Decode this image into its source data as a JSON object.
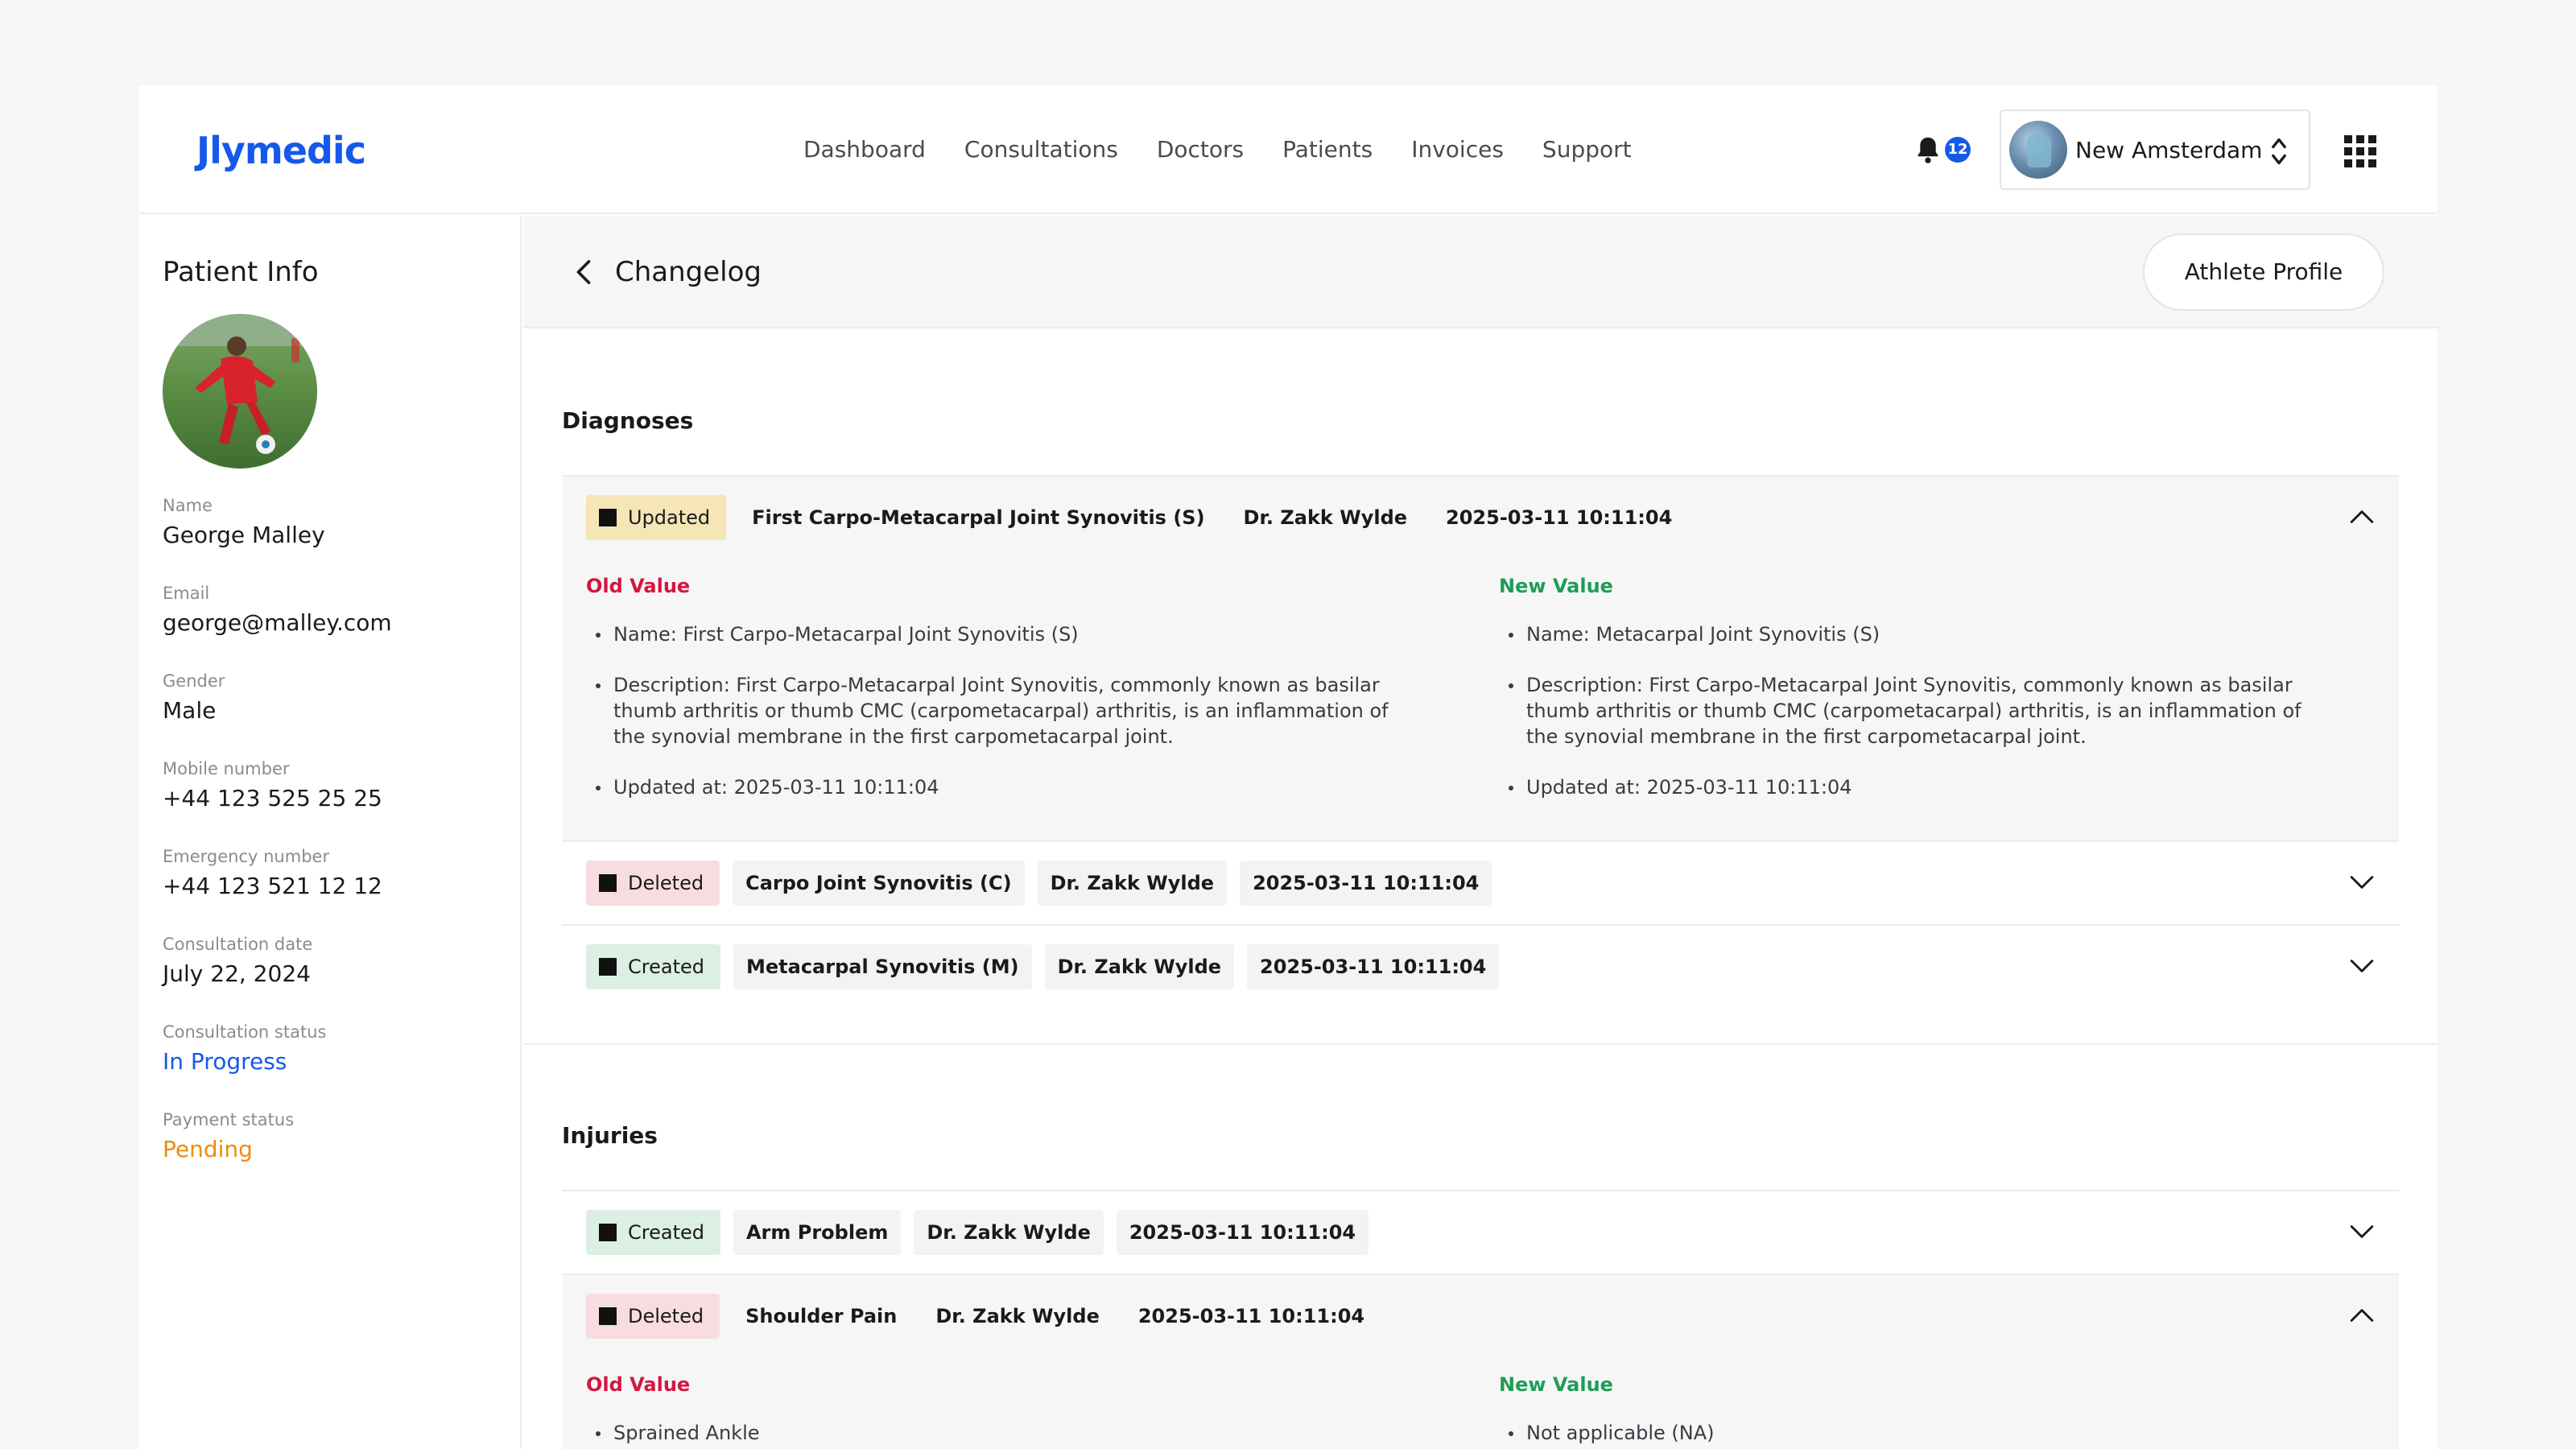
{
  "header": {
    "logo": "Jlymedic",
    "nav": [
      "Dashboard",
      "Consultations",
      "Doctors",
      "Patients",
      "Invoices",
      "Support"
    ],
    "notifications_count": "12",
    "organization": "New Amsterdam"
  },
  "sidebar": {
    "title": "Patient Info",
    "fields": [
      {
        "label": "Name",
        "value": "George Malley"
      },
      {
        "label": "Email",
        "value": "george@malley.com"
      },
      {
        "label": "Gender",
        "value": "Male"
      },
      {
        "label": "Mobile number",
        "value": "+44 123 525 25 25"
      },
      {
        "label": "Emergency number",
        "value": "+44 123 521 12 12"
      },
      {
        "label": "Consultation date",
        "value": "July 22, 2024"
      },
      {
        "label": "Consultation status",
        "value": "In Progress"
      },
      {
        "label": "Payment status",
        "value": "Pending"
      }
    ]
  },
  "main": {
    "title": "Changelog",
    "athlete_profile_button": "Athlete Profile",
    "diagnoses": {
      "title": "Diagnoses",
      "entries": [
        {
          "action": "Updated",
          "item": "First Carpo-Metacarpal Joint Synovitis (S)",
          "doctor": "Dr. Zakk Wylde",
          "timestamp": "2025-03-11 10:11:04",
          "expanded": true
        },
        {
          "action": "Deleted",
          "item": "Carpo Joint Synovitis (C)",
          "doctor": "Dr. Zakk Wylde",
          "timestamp": "2025-03-11 10:11:04",
          "expanded": false
        },
        {
          "action": "Created",
          "item": "Metacarpal Synovitis (M)",
          "doctor": "Dr. Zakk Wylde",
          "timestamp": "2025-03-11 10:11:04",
          "expanded": false
        }
      ],
      "detail": {
        "old_label": "Old Value",
        "new_label": "New Value",
        "old": [
          "Name: First Carpo-Metacarpal Joint Synovitis (S)",
          "Description: First Carpo-Metacarpal Joint Synovitis, commonly known as basilar thumb arthritis or thumb CMC (carpometacarpal) arthritis, is an inflammation of the synovial membrane in the first carpometacarpal joint.",
          "Updated at: 2025-03-11 10:11:04"
        ],
        "new": [
          "Name: Metacarpal Joint Synovitis (S)",
          "Description: First Carpo-Metacarpal Joint Synovitis, commonly known as basilar thumb arthritis or thumb CMC (carpometacarpal) arthritis, is an inflammation of the synovial membrane in the first carpometacarpal joint.",
          "Updated at: 2025-03-11 10:11:04"
        ]
      }
    },
    "injuries": {
      "title": "Injuries",
      "entries": [
        {
          "action": "Created",
          "item": "Arm Problem",
          "doctor": "Dr. Zakk Wylde",
          "timestamp": "2025-03-11 10:11:04",
          "expanded": false
        },
        {
          "action": "Deleted",
          "item": "Shoulder Pain",
          "doctor": "Dr. Zakk Wylde",
          "timestamp": "2025-03-11 10:11:04",
          "expanded": true
        }
      ],
      "detail": {
        "old_label": "Old Value",
        "new_label": "New Value",
        "old": [
          "Sprained Ankle"
        ],
        "new": [
          "Not applicable (NA)"
        ]
      }
    }
  },
  "colors": {
    "brand": "#1559ea",
    "old_value": "#d21740",
    "new_value": "#1f9d55",
    "pending": "#f08b0a",
    "updated_tag": "#f6e5b6",
    "deleted_tag": "#f7dde0",
    "created_tag": "#dcefe3"
  }
}
